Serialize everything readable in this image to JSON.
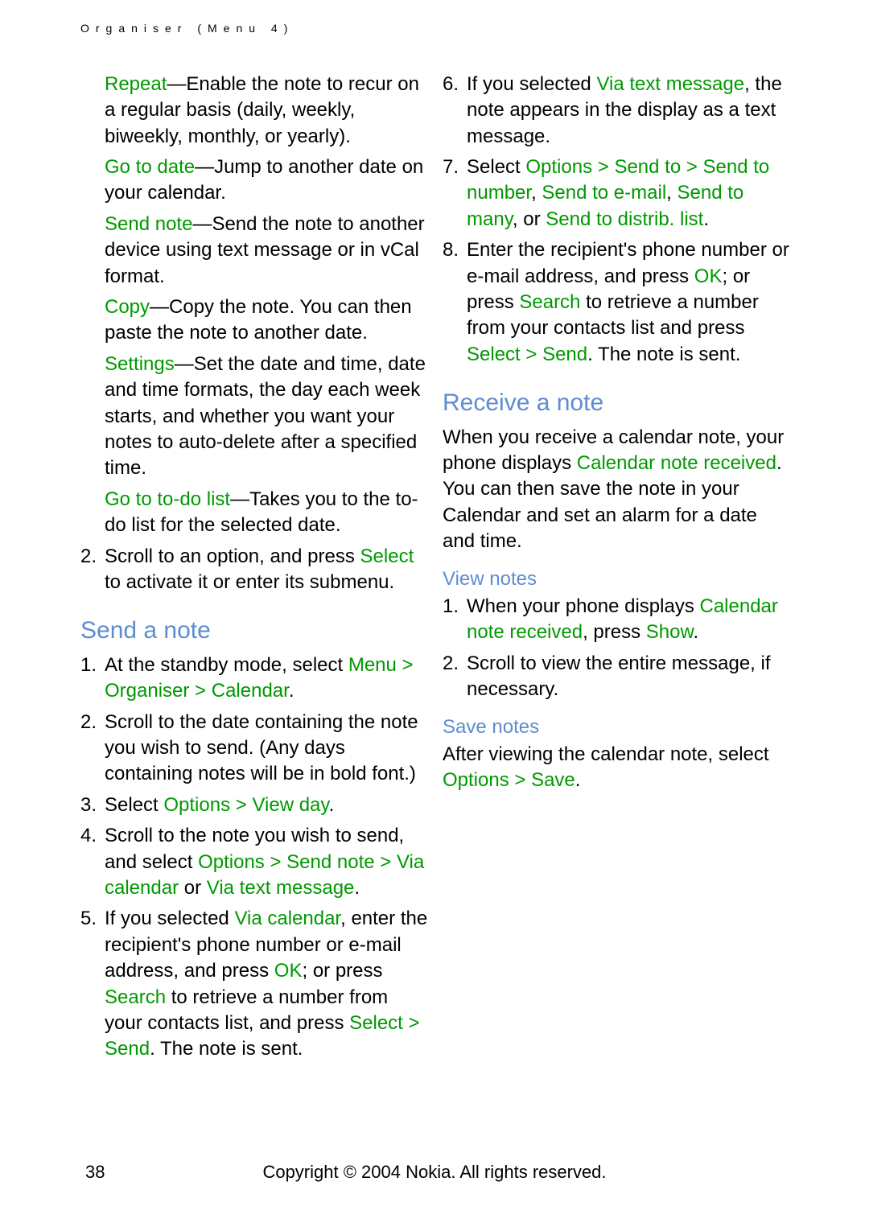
{
  "header": "Organiser (Menu 4)",
  "left": {
    "opts": [
      {
        "term": "Repeat",
        "rest": "—Enable the note to recur on a regular basis (daily, weekly, biweekly, monthly, or yearly)."
      },
      {
        "term": "Go to date",
        "rest": "—Jump to another date on your calendar."
      },
      {
        "term": "Send note",
        "rest": "—Send the note to another device using text message or in vCal format."
      },
      {
        "term": "Copy",
        "rest": "—Copy the note. You can then paste the note to another date."
      },
      {
        "term": "Settings",
        "rest": "—Set the date and time, date and time formats, the day each week starts, and whether you want your notes to auto-delete after a specified time."
      },
      {
        "term": "Go to to-do list",
        "rest": "—Takes you to the to-do list for the selected date."
      }
    ],
    "step2_a": "Scroll to an option, and press ",
    "step2_b": "Select",
    "step2_c": " to activate it or enter its submenu.",
    "send_heading": "Send a note",
    "s1_a": "At the standby mode, select ",
    "s1_b": "Menu",
    "s1_c": "Organiser",
    "s1_d": "Calendar",
    "s2": "Scroll to the date containing the note you wish to send. (Any days containing notes will be in bold font.)",
    "s3_a": "Select ",
    "s3_b": "Options",
    "s3_c": "View day",
    "s4_a": "Scroll to the note you wish to send, and select ",
    "s4_b": "Options",
    "s4_c": "Send note",
    "s4_d": "Via calendar",
    "s4_e": " or ",
    "s4_f": "Via text message"
  },
  "right": {
    "s5_a": "If you selected ",
    "s5_b": "Via calendar",
    "s5_c": ", enter the recipient's phone number or e-mail address, and press ",
    "s5_d": "OK",
    "s5_e": "; or press ",
    "s5_f": "Search",
    "s5_g": " to retrieve a number from your contacts list, and press ",
    "s5_h": "Select",
    "s5_i": "Send",
    "s5_j": ". The note is sent.",
    "s6_a": "If you selected ",
    "s6_b": "Via text message",
    "s6_c": ", the note appears in the display as a text message.",
    "s7_a": "Select ",
    "s7_b": "Options",
    "s7_c": "Send to",
    "s7_d": "Send to number",
    "s7_e": "Send to e-mail",
    "s7_f": "Send to many",
    "s7_g": ", or ",
    "s7_h": "Send to distrib. list",
    "s8_a": "Enter the recipient's phone number or e-mail address, and press ",
    "s8_b": "OK",
    "s8_c": "; or press ",
    "s8_d": "Search",
    "s8_e": " to retrieve a number from your contacts list and press ",
    "s8_f": "Select",
    "s8_g": "Send",
    "s8_h": ". The note is sent.",
    "recv_heading": "Receive a note",
    "recv_p_a": "When you receive a calendar note, your phone displays ",
    "recv_p_b": "Calendar note received",
    "recv_p_c": ". You can then save the note in your Calendar and set an alarm for a date and time.",
    "view_heading": "View notes",
    "v1_a": "When your phone displays ",
    "v1_b": "Calendar note received",
    "v1_c": ", press ",
    "v1_d": "Show",
    "v2": "Scroll to view the entire message, if necessary.",
    "save_heading": "Save notes",
    "save_a": "After viewing the calendar note, select ",
    "save_b": "Options",
    "save_c": "Save"
  },
  "footer": "Copyright © 2004 Nokia. All rights reserved.",
  "pagenum": "38",
  "glyph_arrow": " > "
}
